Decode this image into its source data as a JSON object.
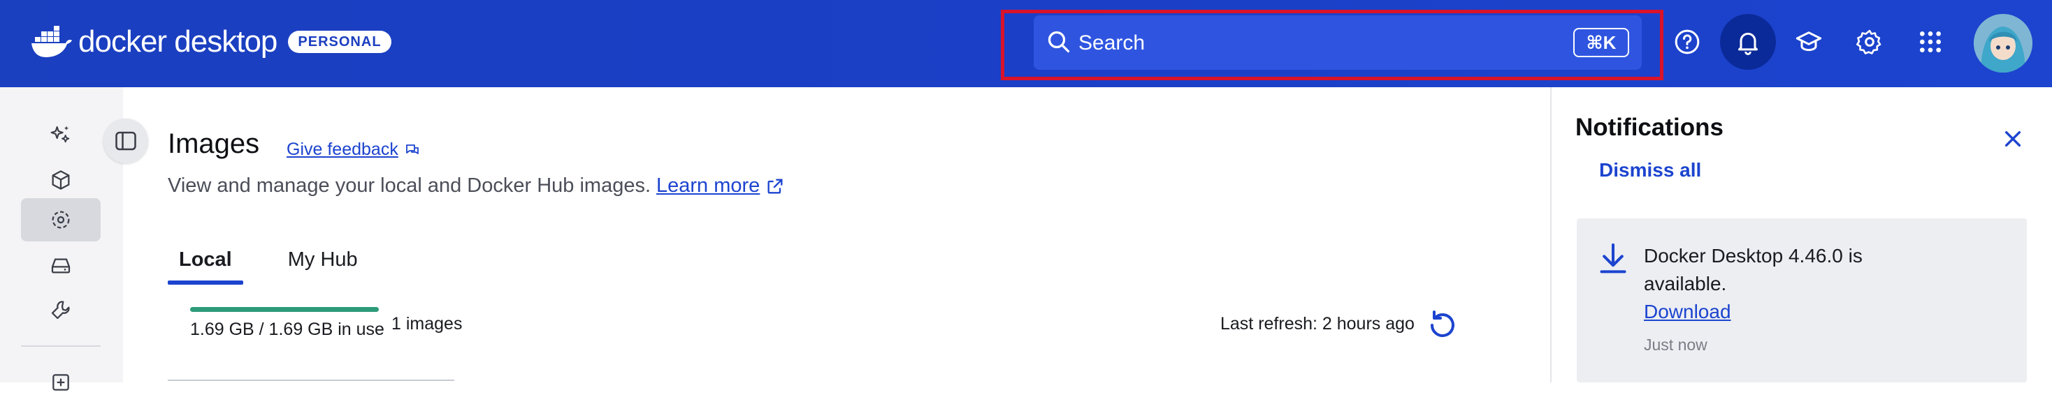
{
  "header": {
    "brand": "docker desktop",
    "plan_badge": "PERSONAL",
    "search": {
      "placeholder": "Search",
      "shortcut": "⌘K"
    },
    "icons": [
      "help-icon",
      "bell-icon",
      "learning-center-icon",
      "gear-icon",
      "apps-grid-icon"
    ],
    "brand_color": "#1c3fbf",
    "highlight_color": "#d9132a"
  },
  "rail": {
    "items": [
      "ai-sparkle-icon",
      "containers-icon",
      "images-icon",
      "volumes-icon",
      "build-tools-icon",
      "extensions-icon"
    ],
    "active_index": 2
  },
  "main": {
    "title": "Images",
    "feedback_label": "Give feedback",
    "subtitle": "View and manage your local and Docker Hub images.",
    "learn_more": "Learn more",
    "tabs": [
      {
        "label": "Local",
        "active": true
      },
      {
        "label": "My Hub",
        "active": false
      }
    ],
    "usage_text": "1.69 GB / 1.69 GB in use",
    "usage_fraction": 1.0,
    "images_count": "1 images",
    "last_refresh": "Last refresh: 2 hours ago",
    "accent_color": "#1c44cf",
    "usage_color": "#2d9b7a"
  },
  "notifications": {
    "title": "Notifications",
    "dismiss_all": "Dismiss all",
    "items": [
      {
        "message": "Docker Desktop 4.46.0 is available.",
        "action": "Download",
        "time": "Just now"
      }
    ]
  }
}
